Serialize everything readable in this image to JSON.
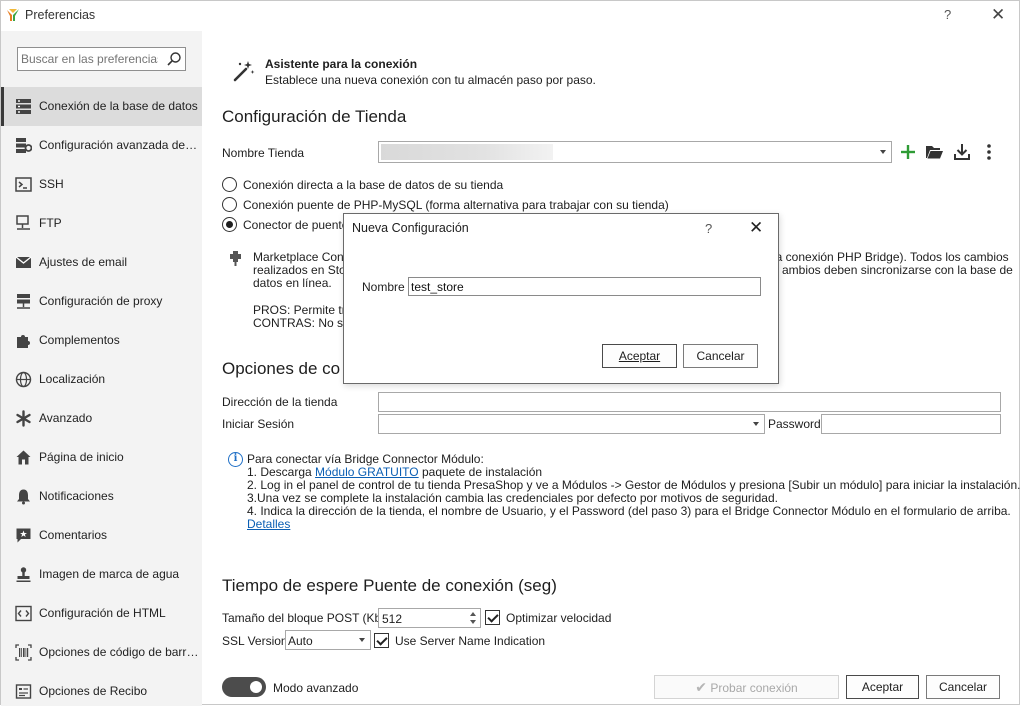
{
  "window": {
    "title": "Preferencias",
    "help": "?",
    "close": "✕"
  },
  "sidebar": {
    "search_placeholder": "Buscar en las preferencias",
    "items": [
      {
        "label": "Conexión de la base de datos",
        "icon": "database-icon",
        "active": true
      },
      {
        "label": "Configuración avanzada de la base",
        "icon": "database-settings-icon"
      },
      {
        "label": "SSH",
        "icon": "terminal-icon"
      },
      {
        "label": "FTP",
        "icon": "network-icon"
      },
      {
        "label": "Ajustes de email",
        "icon": "email-icon"
      },
      {
        "label": "Configuración de proxy",
        "icon": "proxy-icon"
      },
      {
        "label": "Complementos",
        "icon": "puzzle-icon"
      },
      {
        "label": "Localización",
        "icon": "globe-icon"
      },
      {
        "label": "Avanzado",
        "icon": "asterisk-icon"
      },
      {
        "label": "Página de inicio",
        "icon": "home-icon"
      },
      {
        "label": "Notificaciones",
        "icon": "bell-icon"
      },
      {
        "label": "Comentarios",
        "icon": "comment-icon"
      },
      {
        "label": "Imagen de marca de agua",
        "icon": "stamp-icon"
      },
      {
        "label": "Configuración de HTML",
        "icon": "code-icon"
      },
      {
        "label": "Opciones de código de barras",
        "icon": "barcode-icon"
      },
      {
        "label": "Opciones de Recibo",
        "icon": "receipt-icon"
      }
    ]
  },
  "wizard": {
    "title": "Asistente para la conexión",
    "description": "Establece una nueva conexión con tu almacén paso por paso."
  },
  "store_config": {
    "heading": "Configuración de Tienda",
    "store_name_label": "Nombre Tienda",
    "store_name_value": ""
  },
  "connection_options": [
    {
      "label": "Conexión directa a la base de datos de su tienda",
      "selected": false
    },
    {
      "label": "Conexión puente de PHP-MySQL (forma alternativa para trabajar con su tienda)",
      "selected": false
    },
    {
      "label": "Conector de puente de",
      "selected": true
    }
  ],
  "marketplace_info": {
    "line1_left": "Marketplace Conne",
    "line1_right": "la conexión PHP Bridge). Todos los cambios",
    "line2_left": "realizados en Store",
    "line2_right": "ambios deben sincronizarse con la base de",
    "line3": "datos en línea.",
    "pros": "PROS: Permite trab",
    "contras": "CONTRAS: No se r"
  },
  "options_section": {
    "heading": "Opciones de co",
    "store_address_label": "Dirección de la tienda",
    "store_address_value": "",
    "login_label": "Iniciar Sesión",
    "login_value": "",
    "password_label": "Password",
    "password_value": ""
  },
  "bridge_info": {
    "intro": "Para conectar vía Bridge Connector Módulo:",
    "step1_a": "1. Descarga ",
    "step1_link": "Módulo GRATUITO",
    "step1_b": " paquete de instalación",
    "step2": "2. Log in el panel de control de tu tienda PresaShop y ve a Módulos -> Gestor de Módulos  y presiona [Subir un módulo] para iniciar la instalación.",
    "step3": "3.Una vez se complete la instalación cambia las credenciales por defecto por motivos de seguridad.",
    "step4": "4. Indica la dirección de la tienda, el nombre de Usuario, y el Password (del paso 3) para el Bridge Connector Módulo en el formulario de arriba.",
    "details_link": "Detalles"
  },
  "timeout_section": {
    "heading": "Tiempo de espere Puente de conexión (seg)",
    "post_block_label": "Tamaño del bloque POST (Kb)",
    "post_block_value": "512",
    "optimize_label": "Optimizar velocidad",
    "optimize_checked": true,
    "ssl_label": "SSL Version",
    "ssl_value": "Auto",
    "sni_label": "Use Server Name Indication",
    "sni_checked": true
  },
  "footer": {
    "advanced_mode_label": "Modo avanzado",
    "advanced_mode_on": true,
    "test_button": "Probar conexión",
    "accept_button": "Aceptar",
    "cancel_button": "Cancelar"
  },
  "dialog": {
    "title": "Nueva Configuración",
    "help": "?",
    "close": "✕",
    "name_label": "Nombre",
    "name_value": "test_store",
    "accept_button": "Aceptar",
    "cancel_button": "Cancelar"
  },
  "colors": {
    "accent_green": "#2e9b35",
    "link_blue": "#0b5fb4",
    "sidebar_bg": "#f3f3f3"
  }
}
